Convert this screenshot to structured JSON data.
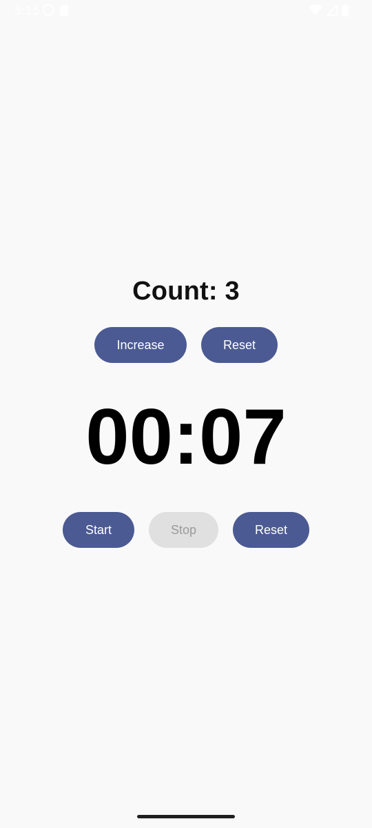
{
  "status_bar": {
    "time": "3:15",
    "icons": [
      "shield-icon",
      "sd-card-icon",
      "wifi-icon",
      "signal-icon",
      "battery-icon"
    ]
  },
  "counter": {
    "label": "Count: 3",
    "value": 3,
    "increase_label": "Increase",
    "reset_label": "Reset"
  },
  "timer": {
    "display": "00:07",
    "start_label": "Start",
    "stop_label": "Stop",
    "stop_enabled": false,
    "reset_label": "Reset"
  },
  "colors": {
    "accent": "#4b5a92",
    "disabled_bg": "#e0e0e0",
    "disabled_text": "#9a9a9a",
    "background": "#f9f9f9"
  }
}
